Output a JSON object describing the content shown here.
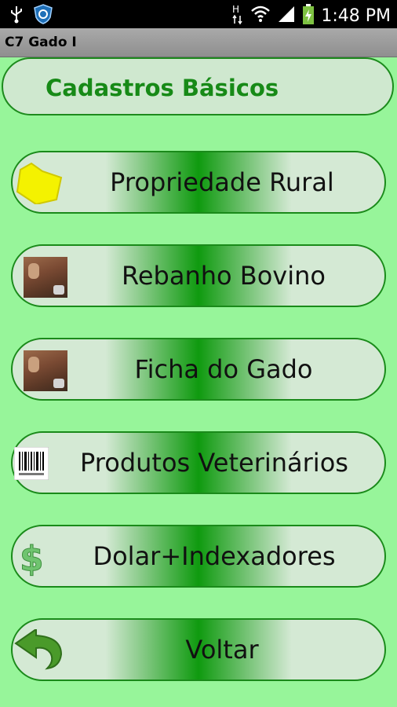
{
  "statusbar": {
    "time": "1:48 PM",
    "network": "H"
  },
  "app": {
    "title": "C7 Gado I"
  },
  "header": {
    "title": "Cadastros Básicos"
  },
  "menu": [
    {
      "label": "Propriedade Rural",
      "icon": "map-icon"
    },
    {
      "label": "Rebanho Bovino",
      "icon": "cattle-icon"
    },
    {
      "label": "Ficha do Gado",
      "icon": "cattle-icon"
    },
    {
      "label": "Produtos Veterinários",
      "icon": "barcode-icon"
    },
    {
      "label": "Dolar+Indexadores",
      "icon": "dollar-icon"
    },
    {
      "label": "Voltar",
      "icon": "back-arrow-icon"
    }
  ],
  "colors": {
    "background": "#97f59a",
    "accent": "#178a17",
    "button_center": "#0f9a0f"
  }
}
